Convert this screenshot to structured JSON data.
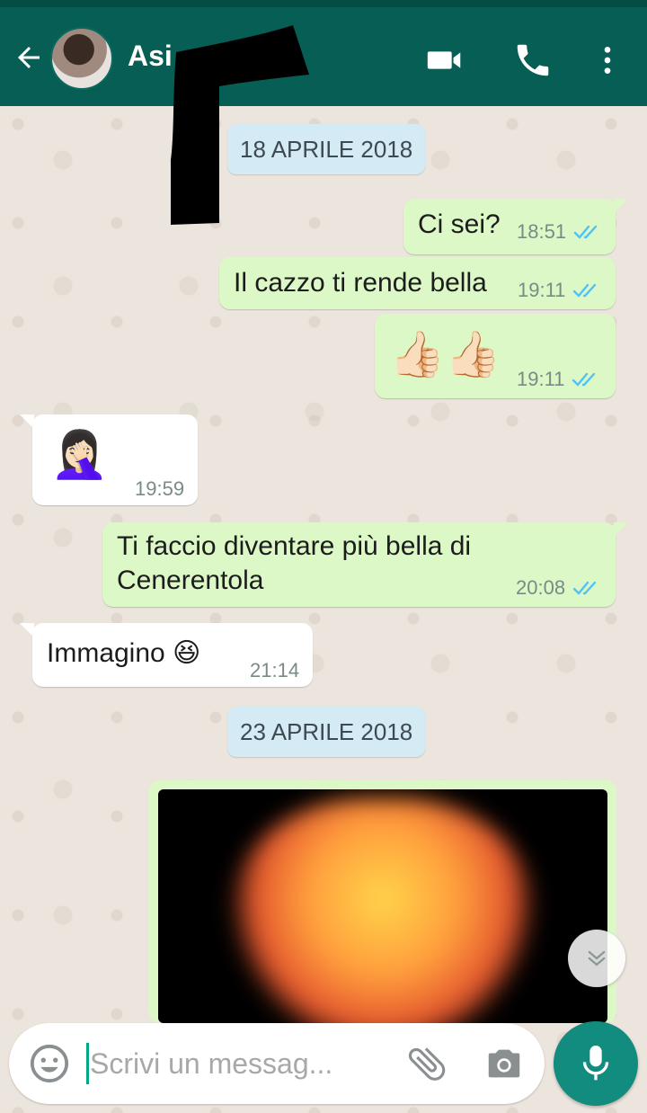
{
  "header": {
    "contact_name": "Asi",
    "back_icon": "arrow-left-icon",
    "video_icon": "video-camera-icon",
    "call_icon": "phone-icon",
    "menu_icon": "more-vertical-icon",
    "bar_color": "#075e54"
  },
  "chat": {
    "date_1": "18 APRILE 2018",
    "date_2": "23 APRILE 2018",
    "messages": [
      {
        "direction": "out",
        "text": "Ci sei?",
        "time": "18:51",
        "read": true
      },
      {
        "direction": "out",
        "text": "Il cazzo ti rende bella",
        "time": "19:11",
        "read": true
      },
      {
        "direction": "out",
        "text": "👍🏻👍🏻",
        "time": "19:11",
        "read": true
      },
      {
        "direction": "in",
        "text": "🤦🏻‍♀️",
        "time": "19:59"
      },
      {
        "direction": "out",
        "text_line1": "Ti faccio diventare più bella di",
        "text_line2": "Cenerentola",
        "time": "20:08",
        "read": true
      },
      {
        "direction": "in",
        "text": "Immagino 😆",
        "time": "21:14"
      }
    ],
    "outgoing_color": "#dcf8c6",
    "incoming_color": "#ffffff",
    "read_tick_color": "#4fc3f7"
  },
  "composer": {
    "placeholder": "Scrivi un messag...",
    "emoji_icon": "smiley-icon",
    "attach_icon": "paperclip-icon",
    "camera_icon": "camera-icon",
    "mic_icon": "microphone-icon",
    "accent": "#128c7e"
  },
  "scroll_down_icon": "double-chevron-down-icon"
}
